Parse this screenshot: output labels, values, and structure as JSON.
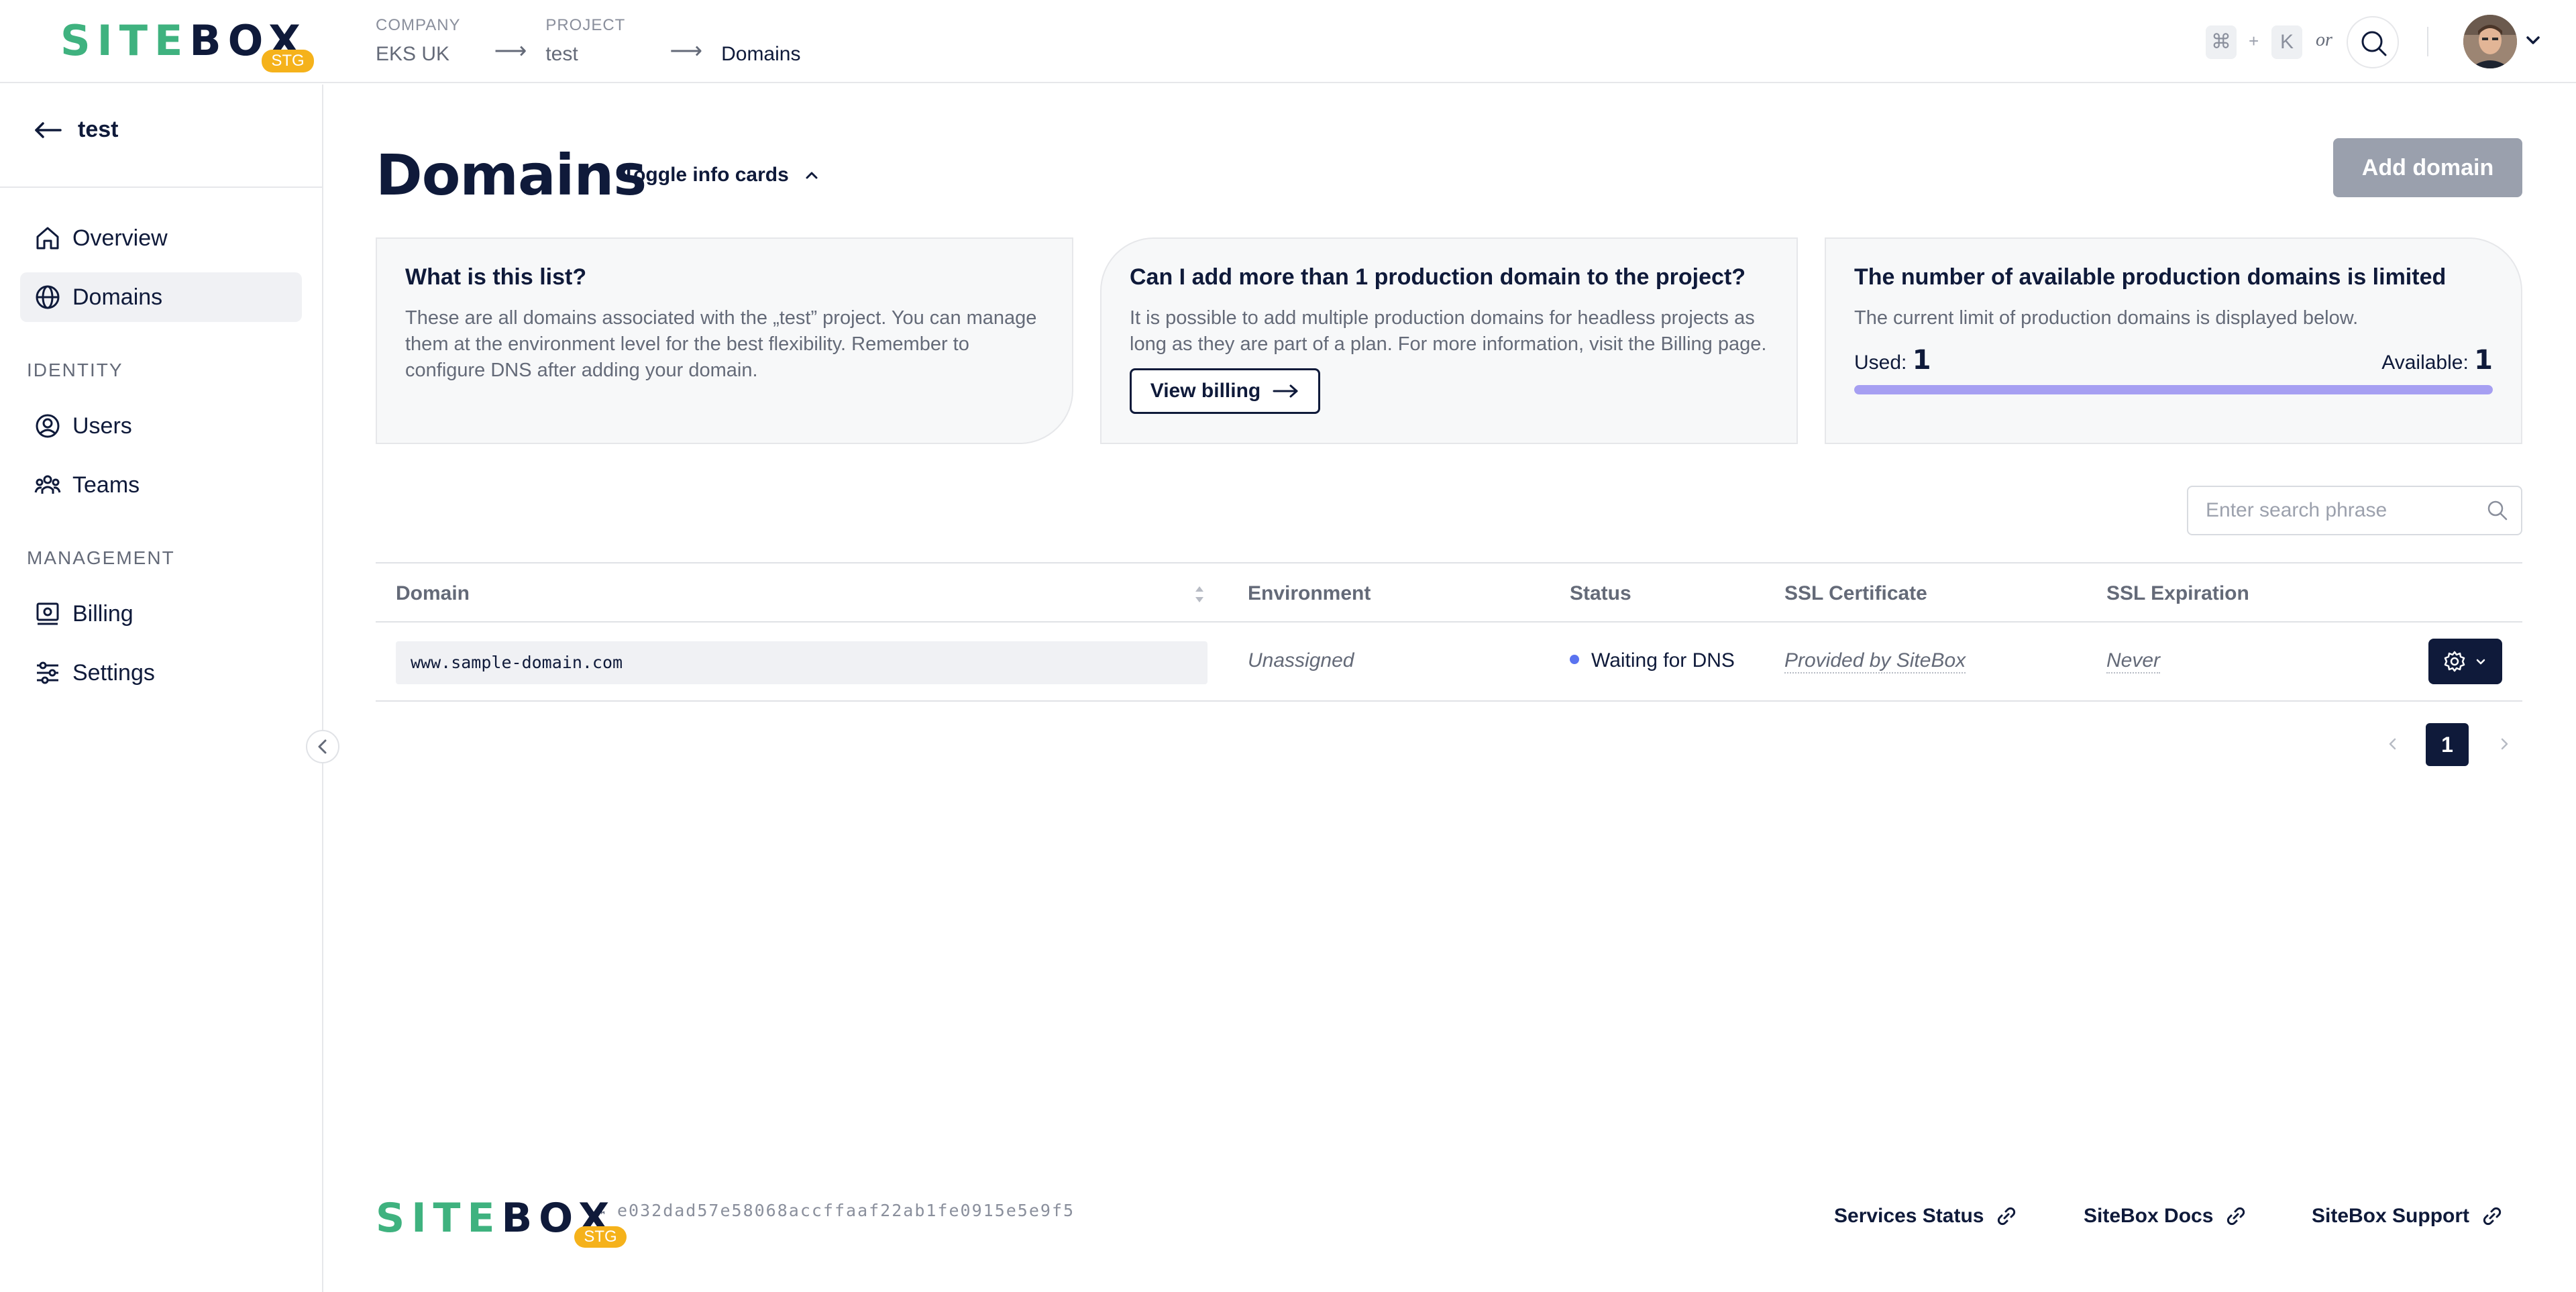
{
  "brand": {
    "name_part1": "SITE",
    "name_part2": "BOX",
    "env_badge": "STG",
    "tm": "™",
    "accent_color": "#3fb27f",
    "dark_color": "#0f1a3a"
  },
  "breadcrumb": {
    "company_label": "COMPANY",
    "company_value": "EKS UK",
    "project_label": "PROJECT",
    "project_value": "test",
    "current": "Domains"
  },
  "shortcut": {
    "cmd": "⌘",
    "plus": "+",
    "key": "K",
    "or": "or"
  },
  "sidebar": {
    "back_label": "test",
    "items": [
      {
        "label": "Overview",
        "icon": "home-icon"
      },
      {
        "label": "Domains",
        "icon": "globe-icon",
        "active": true
      }
    ],
    "identity_title": "IDENTITY",
    "identity_items": [
      {
        "label": "Users",
        "icon": "user-circle-icon"
      },
      {
        "label": "Teams",
        "icon": "team-icon"
      }
    ],
    "management_title": "MANAGEMENT",
    "management_items": [
      {
        "label": "Billing",
        "icon": "billing-icon"
      },
      {
        "label": "Settings",
        "icon": "sliders-icon"
      }
    ]
  },
  "main": {
    "title": "Domains",
    "toggle_label": "Toggle info cards",
    "add_button": "Add domain",
    "cards": [
      {
        "title": "What is this list?",
        "text": "These are all domains associated with the „test” project. You can manage them at the environment level for the best flexibility. Remember to configure DNS after adding your domain."
      },
      {
        "title": "Can I add more than 1 production domain to the project?",
        "text": "It is possible to add multiple production domains for headless projects as long as they are part of a plan. For more information, visit the Billing page.",
        "button": "View billing"
      },
      {
        "title": "The number of available production domains is limited",
        "text": "The current limit of production domains is displayed below.",
        "used_label": "Used:",
        "used_value": "1",
        "available_label": "Available:",
        "available_value": "1",
        "usage_fraction": 1.0
      }
    ],
    "search_placeholder": "Enter search phrase",
    "table": {
      "columns": [
        "Domain",
        "Environment",
        "Status",
        "SSL Certificate",
        "SSL Expiration"
      ],
      "rows": [
        {
          "domain": "www.sample-domain.com",
          "environment": "Unassigned",
          "status": "Waiting for DNS",
          "status_color": "#5a73f0",
          "ssl_certificate": "Provided by SiteBox",
          "ssl_expiration": "Never"
        }
      ]
    },
    "pagination": {
      "current_page": "1"
    }
  },
  "footer": {
    "build_hash": "e032dad57e58068accffaaf22ab1fe0915e5e9f5",
    "links": [
      "Services Status",
      "SiteBox Docs",
      "SiteBox Support"
    ]
  }
}
